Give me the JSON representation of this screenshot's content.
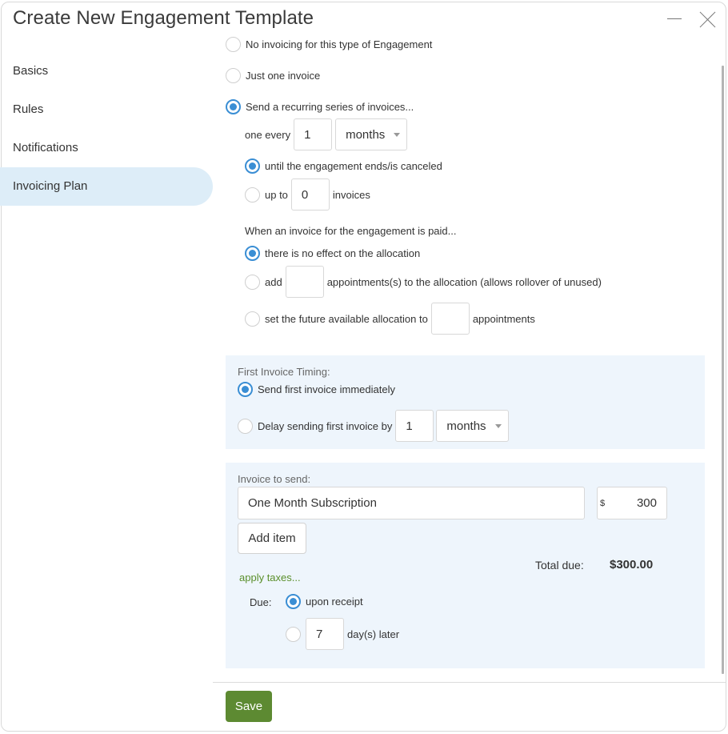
{
  "window": {
    "title": "Create New Engagement Template",
    "minimize_icon": "minimize-icon",
    "close_icon": "close-icon"
  },
  "sidebar": {
    "items": [
      {
        "label": "Basics",
        "active": false
      },
      {
        "label": "Rules",
        "active": false
      },
      {
        "label": "Notifications",
        "active": false
      },
      {
        "label": "Invoicing Plan",
        "active": true
      }
    ]
  },
  "invoicing": {
    "options": {
      "none": {
        "label": "No invoicing for this type of Engagement",
        "checked": false
      },
      "one": {
        "label": "Just one invoice",
        "checked": false
      },
      "recurring": {
        "label": "Send a recurring series of invoices...",
        "checked": true
      }
    },
    "frequency": {
      "prefix": "one every",
      "value": "1",
      "unit": "months"
    },
    "duration": {
      "until_label": "until the engagement ends/is canceled",
      "until_checked": true,
      "upto_prefix": "up to",
      "upto_value": "0",
      "upto_suffix": "invoices",
      "upto_checked": false
    },
    "paid": {
      "heading": "When an invoice for the engagement is paid...",
      "no_effect_label": "there is no effect on the allocation",
      "no_effect_checked": true,
      "add_prefix": "add",
      "add_value": "",
      "add_suffix": "appointments(s) to the allocation (allows rollover of unused)",
      "add_checked": false,
      "set_prefix": "set the future available allocation to",
      "set_value": "",
      "set_suffix": "appointments",
      "set_checked": false
    }
  },
  "first_invoice": {
    "heading": "First Invoice Timing:",
    "immediate_label": "Send first invoice immediately",
    "immediate_checked": true,
    "delay_label": "Delay sending first invoice by",
    "delay_checked": false,
    "delay_value": "1",
    "delay_unit": "months"
  },
  "invoice_to_send": {
    "heading": "Invoice to send:",
    "item_description": "One Month Subscription",
    "currency_symbol": "$",
    "item_amount": "300",
    "add_item_label": "Add item",
    "total_label": "Total due:",
    "total_value": "$300.00",
    "apply_taxes_label": "apply taxes...",
    "due_label": "Due:",
    "upon_receipt_label": "upon receipt",
    "upon_receipt_checked": true,
    "days_value": "7",
    "days_suffix": "day(s) later",
    "days_checked": false
  },
  "footer": {
    "save_label": "Save",
    "save_color": "#5d8a32"
  },
  "colors": {
    "accent": "#3a8ed4",
    "panel_bg": "#eef5fc",
    "active_nav_bg": "#ddedf8",
    "link": "#5a8f2b"
  }
}
